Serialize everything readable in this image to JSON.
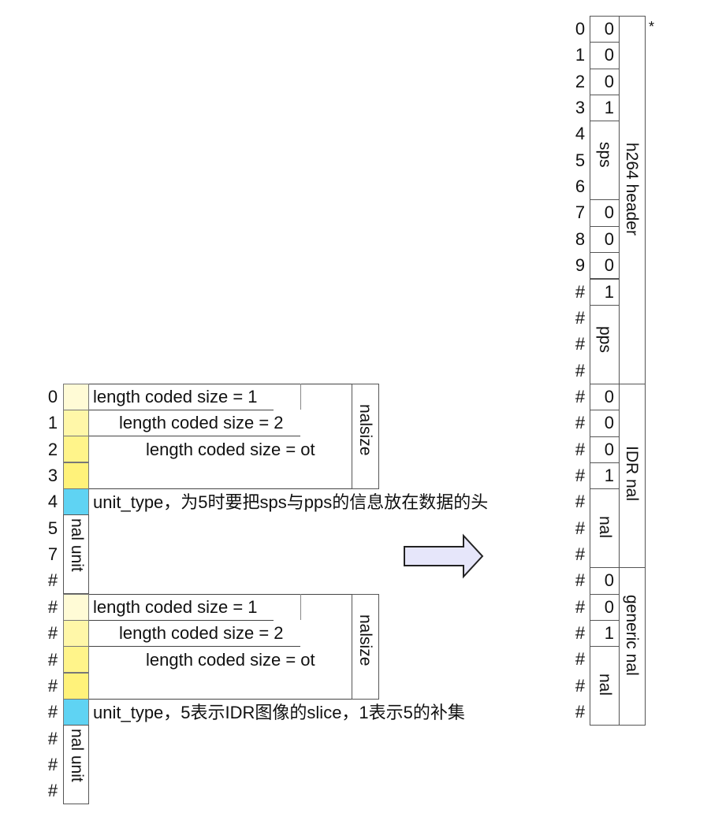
{
  "right_table": {
    "asterisk": "*",
    "rows": [
      "0",
      "1",
      "2",
      "3",
      "4",
      "5",
      "6",
      "7",
      "8",
      "9",
      "#",
      "#",
      "#",
      "#",
      "#",
      "#",
      "#",
      "#",
      "#",
      "#",
      "#",
      "#",
      "#",
      "#",
      "#",
      "#",
      "#"
    ],
    "values": [
      "0",
      "0",
      "0",
      "1",
      "",
      "",
      "",
      "0",
      "0",
      "0",
      "1",
      "",
      "",
      "",
      "0",
      "0",
      "0",
      "1",
      "",
      "",
      "",
      "0",
      "0",
      "1",
      "",
      "",
      ""
    ],
    "sub_labels": {
      "sps": "sps",
      "pps": "pps",
      "nal_idr": "nal",
      "nal_generic": "nal"
    },
    "group_labels": {
      "h264_header": "h264 header",
      "idr_nal": "IDR nal",
      "generic_nal": "generic nal"
    }
  },
  "left_table": {
    "block1": {
      "rows": [
        "0",
        "1",
        "2",
        "3",
        "4",
        "5",
        "7",
        "#"
      ],
      "size_lines": [
        "length coded size = 1",
        "length coded size = 2",
        "length coded size = ot"
      ],
      "nalsize": "nalsize",
      "unit_type": "unit_type，为5时要把sps与pps的信息放在数据的头",
      "nal_unit": "nal unit"
    },
    "block2": {
      "rows": [
        "#",
        "#",
        "#",
        "#",
        "#",
        "#",
        "#",
        "#"
      ],
      "size_lines": [
        "length coded size = 1",
        "length coded size = 2",
        "length coded size = ot"
      ],
      "nalsize": "nalsize",
      "unit_type": "unit_type，5表示IDR图像的slice，1表示5的补集",
      "nal_unit": "nal unit"
    },
    "colors": {
      "size1": "#fffbd6",
      "size2": "#fff7a8",
      "size3": "#fff48a",
      "size4": "#fff27a",
      "unit_type": "#5fd3f3"
    }
  },
  "arrow": {
    "direction": "right",
    "fill": "#e6e6fa",
    "stroke": "#222222"
  }
}
